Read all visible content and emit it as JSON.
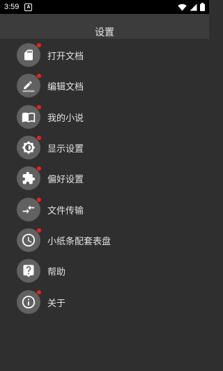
{
  "status_bar": {
    "time": "3:59",
    "notification_icon": "A"
  },
  "header": {
    "title": "设置"
  },
  "menu": {
    "items": [
      {
        "label": "打开文档",
        "icon": "sd-card-icon",
        "badge": true
      },
      {
        "label": "编辑文档",
        "icon": "edit-pencil-icon",
        "badge": true
      },
      {
        "label": "我的小说",
        "icon": "book-icon",
        "badge": true
      },
      {
        "label": "显示设置",
        "icon": "brightness-icon",
        "badge": true
      },
      {
        "label": "偏好设置",
        "icon": "puzzle-icon",
        "badge": true
      },
      {
        "label": "文件传输",
        "icon": "transfer-arrows-icon",
        "badge": true
      },
      {
        "label": "小纸条配套表盘",
        "icon": "clock-icon",
        "badge": true
      },
      {
        "label": "帮助",
        "icon": "help-icon",
        "badge": false
      },
      {
        "label": "关于",
        "icon": "info-icon",
        "badge": true
      }
    ]
  },
  "colors": {
    "background": "#2f2f2f",
    "header": "#3c3c3c",
    "icon_circle": "#616161",
    "badge": "#ff1a1a"
  }
}
